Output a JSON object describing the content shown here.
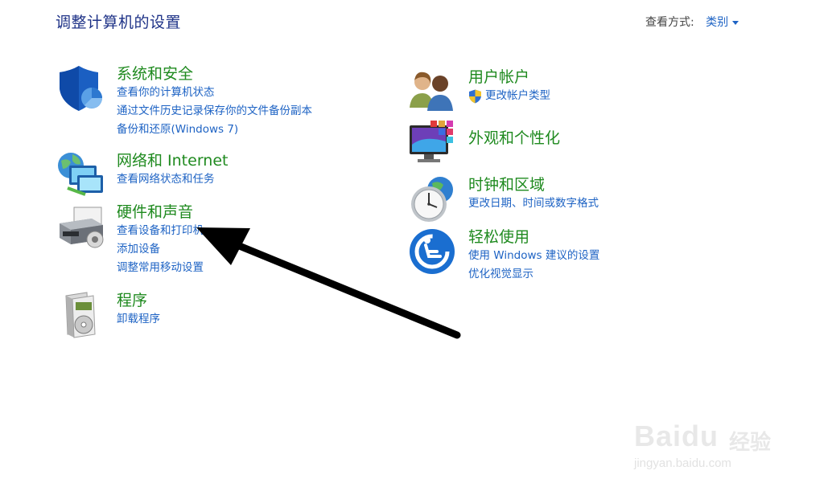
{
  "header": {
    "title": "调整计算机的设置",
    "view_by_label": "查看方式:",
    "view_by_value": "类别"
  },
  "categories": {
    "system_security": {
      "title": "系统和安全",
      "links": [
        "查看你的计算机状态",
        "通过文件历史记录保存你的文件备份副本",
        "备份和还原(Windows 7)"
      ]
    },
    "network_internet": {
      "title": "网络和 Internet",
      "links": [
        "查看网络状态和任务"
      ]
    },
    "hardware_sound": {
      "title": "硬件和声音",
      "links": [
        "查看设备和打印机",
        "添加设备",
        "调整常用移动设置"
      ]
    },
    "programs": {
      "title": "程序",
      "links": [
        "卸载程序"
      ]
    },
    "user_accounts": {
      "title": "用户帐户",
      "links": [
        "更改帐户类型"
      ]
    },
    "appearance": {
      "title": "外观和个性化",
      "links": []
    },
    "clock_region": {
      "title": "时钟和区域",
      "links": [
        "更改日期、时间或数字格式"
      ]
    },
    "ease_of_access": {
      "title": "轻松使用",
      "links": [
        "使用 Windows 建议的设置",
        "优化视觉显示"
      ]
    }
  },
  "watermark": {
    "brand": "Baidu",
    "cn": "经验",
    "url": "jingyan.baidu.com"
  },
  "colors": {
    "title_blue": "#1e3287",
    "link_blue": "#1e63c4",
    "category_green": "#1f8a1f",
    "arrow": "#000000"
  }
}
